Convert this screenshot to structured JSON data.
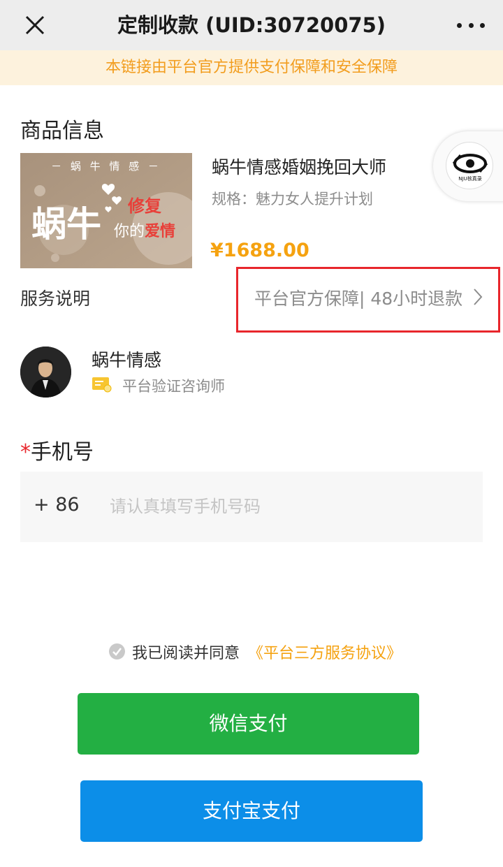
{
  "navbar": {
    "title": "定制收款 (UID:30720075)",
    "close_icon": "close-icon",
    "more_icon": "more-dots-icon"
  },
  "notice": "本链接由平台官方提供支付保障和安全保障",
  "product_section": {
    "title": "商品信息",
    "name": "蜗牛情感婚姻挽回大师",
    "spec": "规格：魅力女人提升计划",
    "price": "¥1688.00",
    "image": {
      "top_text": "－ 蜗 牛 情 感 －",
      "big_text": "蜗牛",
      "line1_a": "修复",
      "line2_a": "你的",
      "line2_b": "爱情"
    }
  },
  "float_badge": {
    "logo_text": "NJU核真录"
  },
  "service": {
    "label": "服务说明",
    "value": "平台官方保障| 48小时退款",
    "arrow_icon": "chevron-right-icon"
  },
  "counselor": {
    "name": "蜗牛情感",
    "verify_text": "平台验证咨询师",
    "verify_icon": "certificate-icon"
  },
  "phone": {
    "required_mark": "*",
    "label": "手机号",
    "country_code": "+ 86",
    "placeholder": "请认真填写手机号码"
  },
  "agreement": {
    "text": "我已阅读并同意",
    "link": "《平台三方服务协议》"
  },
  "buttons": {
    "wechat": "微信支付",
    "alipay": "支付宝支付"
  },
  "colors": {
    "accent_orange": "#f5a210",
    "wechat_green": "#23af43",
    "alipay_blue": "#0c8ee8",
    "highlight_red": "#e8262c"
  }
}
